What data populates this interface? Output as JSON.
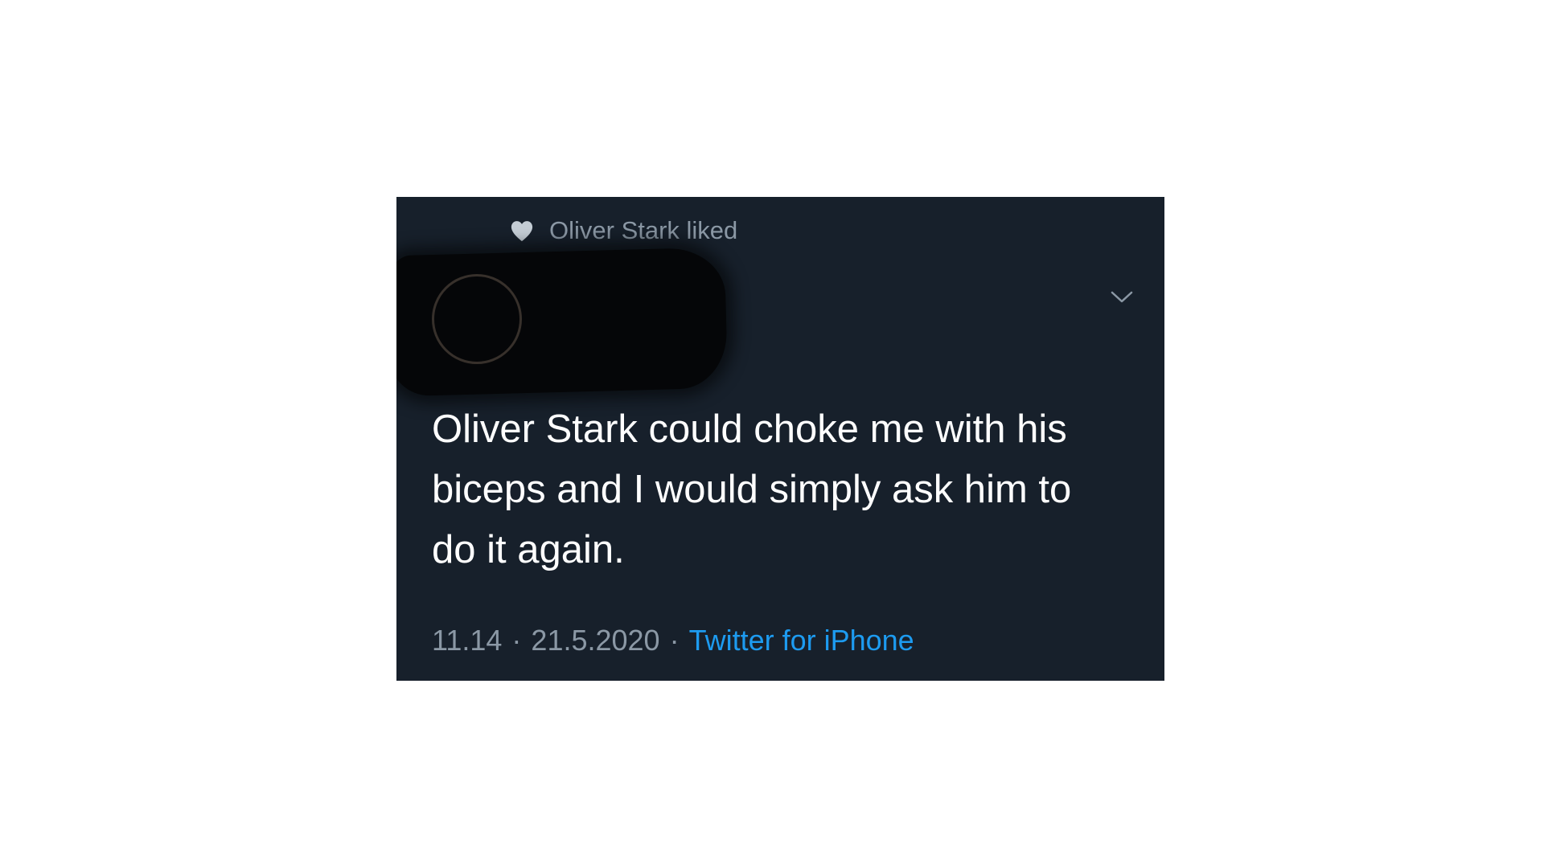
{
  "social_context": {
    "icon": "heart-icon",
    "text": "Oliver Stark liked"
  },
  "author": {
    "redacted": true
  },
  "tweet": {
    "text": "Oliver Stark could choke me with his biceps and I would simply ask him to do it again.",
    "time": "11.14",
    "separator": "·",
    "date": "21.5.2020",
    "source": "Twitter for iPhone"
  },
  "menu": {
    "icon": "chevron-down-icon"
  },
  "colors": {
    "background": "#17202b",
    "text": "#ffffff",
    "muted": "#8b98a5",
    "link": "#1d9bf0"
  }
}
